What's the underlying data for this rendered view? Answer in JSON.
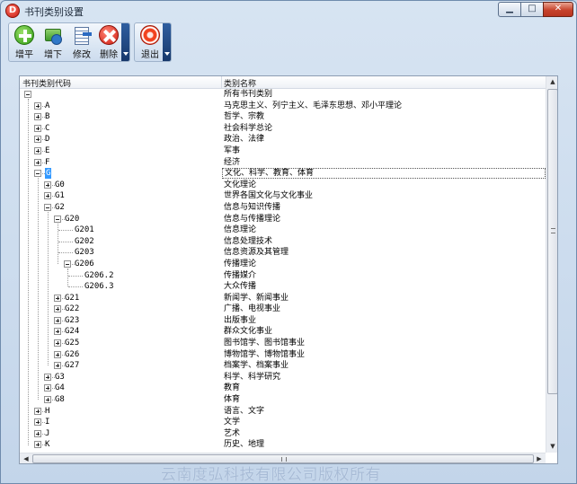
{
  "window": {
    "title": "书刊类别设置",
    "app_icon_glyph": "D",
    "controls": {
      "minimize": "▁",
      "maximize": "□",
      "close": "✕"
    }
  },
  "toolbar": {
    "buttons": [
      {
        "label": "增平",
        "icon": "add-sibling-icon"
      },
      {
        "label": "增下",
        "icon": "add-child-icon"
      },
      {
        "label": "修改",
        "icon": "edit-icon"
      },
      {
        "label": "删除",
        "icon": "delete-icon"
      },
      {
        "label": "退出",
        "icon": "exit-icon"
      }
    ]
  },
  "tree": {
    "columns": {
      "code": "书刊类别代码",
      "name": "类别名称"
    },
    "rows": [
      {
        "code": "",
        "name": "所有书刊类别",
        "level": 0,
        "expander": "minus"
      },
      {
        "code": "A",
        "name": "马克思主义、列宁主义、毛泽东思想、邓小平理论",
        "level": 1,
        "expander": "plus"
      },
      {
        "code": "B",
        "name": "哲学、宗教",
        "level": 1,
        "expander": "plus"
      },
      {
        "code": "C",
        "name": "社会科学总论",
        "level": 1,
        "expander": "plus"
      },
      {
        "code": "D",
        "name": "政治、法律",
        "level": 1,
        "expander": "plus"
      },
      {
        "code": "E",
        "name": "军事",
        "level": 1,
        "expander": "plus"
      },
      {
        "code": "F",
        "name": "经济",
        "level": 1,
        "expander": "plus"
      },
      {
        "code": "G",
        "name": "文化、科学、教育、体育",
        "level": 1,
        "expander": "minus",
        "selected": true
      },
      {
        "code": "G0",
        "name": "文化理论",
        "level": 2,
        "expander": "plus"
      },
      {
        "code": "G1",
        "name": "世界各国文化与文化事业",
        "level": 2,
        "expander": "plus"
      },
      {
        "code": "G2",
        "name": "信息与知识传播",
        "level": 2,
        "expander": "minus"
      },
      {
        "code": "G20",
        "name": "信息与传播理论",
        "level": 3,
        "expander": "minus"
      },
      {
        "code": "G201",
        "name": "信息理论",
        "level": 4,
        "expander": ""
      },
      {
        "code": "G202",
        "name": "信息处理技术",
        "level": 4,
        "expander": ""
      },
      {
        "code": "G203",
        "name": "信息资源及其管理",
        "level": 4,
        "expander": ""
      },
      {
        "code": "G206",
        "name": "传播理论",
        "level": 4,
        "expander": "minus"
      },
      {
        "code": "G206.2",
        "name": "传播媒介",
        "level": 5,
        "expander": ""
      },
      {
        "code": "G206.3",
        "name": "大众传播",
        "level": 5,
        "expander": ""
      },
      {
        "code": "G21",
        "name": "新闻学、新闻事业",
        "level": 3,
        "expander": "plus"
      },
      {
        "code": "G22",
        "name": "广播、电视事业",
        "level": 3,
        "expander": "plus"
      },
      {
        "code": "G23",
        "name": "出版事业",
        "level": 3,
        "expander": "plus"
      },
      {
        "code": "G24",
        "name": "群众文化事业",
        "level": 3,
        "expander": "plus"
      },
      {
        "code": "G25",
        "name": "图书馆学、图书馆事业",
        "level": 3,
        "expander": "plus"
      },
      {
        "code": "G26",
        "name": "博物馆学、博物馆事业",
        "level": 3,
        "expander": "plus"
      },
      {
        "code": "G27",
        "name": "档案学、档案事业",
        "level": 3,
        "expander": "plus"
      },
      {
        "code": "G3",
        "name": "科学、科学研究",
        "level": 2,
        "expander": "plus"
      },
      {
        "code": "G4",
        "name": "教育",
        "level": 2,
        "expander": "plus"
      },
      {
        "code": "G8",
        "name": "体育",
        "level": 2,
        "expander": "plus"
      },
      {
        "code": "H",
        "name": "语言、文字",
        "level": 1,
        "expander": "plus"
      },
      {
        "code": "I",
        "name": "文学",
        "level": 1,
        "expander": "plus"
      },
      {
        "code": "J",
        "name": "艺术",
        "level": 1,
        "expander": "plus"
      },
      {
        "code": "K",
        "name": "历史、地理",
        "level": 1,
        "expander": "plus"
      }
    ]
  },
  "scrollbars": {
    "up": "▲",
    "down": "▼",
    "left": "◀",
    "right": "▶",
    "h_grip": "III"
  },
  "footer": {
    "copyright": "云南度弘科技有限公司版权所有"
  }
}
